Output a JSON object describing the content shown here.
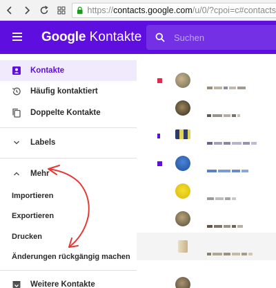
{
  "browser": {
    "url_scheme": "https://",
    "url_host": "contacts.google.com",
    "url_path": "/u/0/?cpoi=c#contacts"
  },
  "header": {
    "brand_google": "Google",
    "brand_product": "Kontakte",
    "search_placeholder": "Suchen"
  },
  "sidebar": {
    "items": [
      {
        "label": "Kontakte",
        "icon": "person-icon"
      },
      {
        "label": "Häufig kontaktiert",
        "icon": "history-icon"
      },
      {
        "label": "Doppelte Kontakte",
        "icon": "copy-icon"
      },
      {
        "label": "Labels",
        "icon": "chevron-down-icon"
      },
      {
        "label": "Mehr",
        "icon": "chevron-up-icon"
      }
    ],
    "more_items": [
      "Importieren",
      "Exportieren",
      "Drucken",
      "Änderungen rückgängig machen"
    ],
    "other_contacts": "Weitere Kontakte"
  },
  "colors": {
    "brand": "#5e0fe0",
    "active_bg": "#f1eafc",
    "annotation": "#e53935"
  }
}
